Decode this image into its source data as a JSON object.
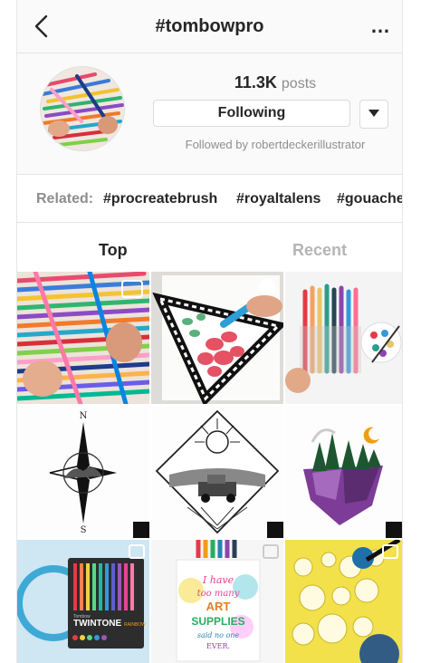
{
  "header": {
    "title": "#tombowpro",
    "more_label": "…"
  },
  "profile": {
    "post_count": "11.3K",
    "post_label": "posts",
    "follow_label": "Following",
    "followed_by": "Followed by robertdeckerillustrator"
  },
  "related": {
    "label": "Related:",
    "tags": [
      "#procreatebrush",
      "#royaltalens",
      "#gouachei"
    ]
  },
  "tabs": {
    "top": "Top",
    "recent": "Recent"
  },
  "grid_text": {
    "compass_n": "N",
    "compass_s": "S",
    "box_brand": "TWINTONE",
    "box_sub": "RAINBOW",
    "box_small": "Tombow",
    "card_line1": "I have",
    "card_line2": "too many",
    "card_line3": "ART",
    "card_line4": "SUPPLIES",
    "card_line5": "said no one",
    "card_line6": "EVER."
  }
}
